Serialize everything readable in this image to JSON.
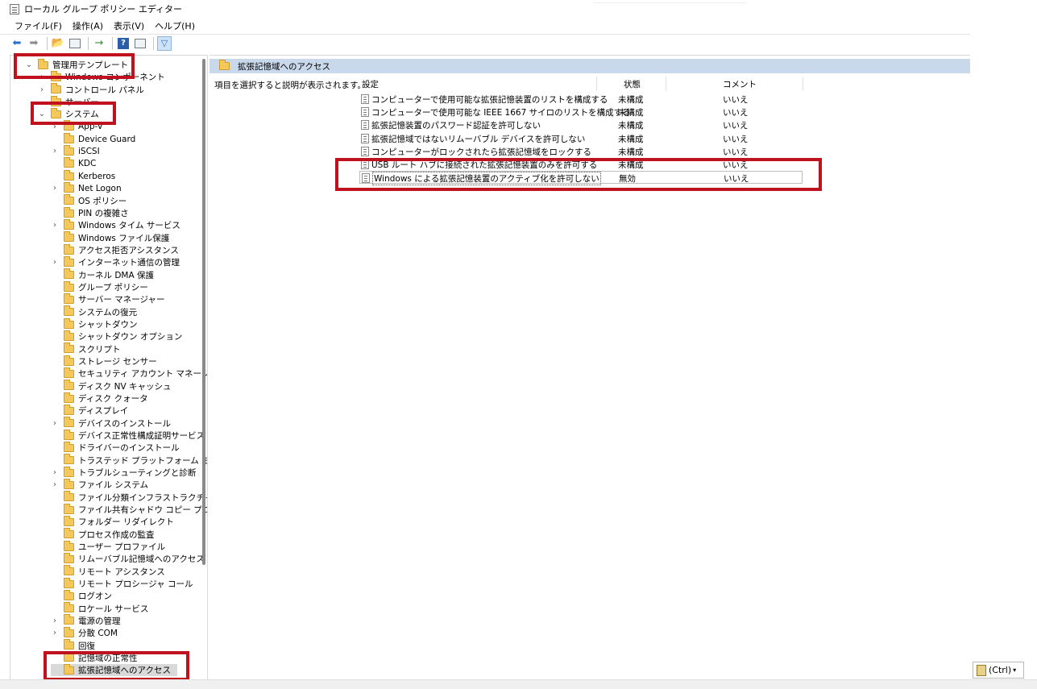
{
  "window": {
    "title": "ローカル グループ ポリシー エディター"
  },
  "menu": [
    "ファイル(F)",
    "操作(A)",
    "表示(V)",
    "ヘルプ(H)"
  ],
  "toolbar": {
    "icons": [
      "back-arrow-icon",
      "forward-arrow-icon",
      "up-folder-icon",
      "show-hide-tree-icon",
      "export-list-icon",
      "help-icon",
      "properties-icon",
      "filter-icon"
    ]
  },
  "tree": [
    {
      "label": "管理用テンプレート",
      "level": 0,
      "expander": "expanded"
    },
    {
      "label": "Windows コンポーネント",
      "level": 1,
      "expander": "collapsed"
    },
    {
      "label": "コントロール パネル",
      "level": 1,
      "expander": "collapsed"
    },
    {
      "label": "サーバー",
      "level": 1,
      "expander": "none"
    },
    {
      "label": "システム",
      "level": 1,
      "expander": "expanded"
    },
    {
      "label": "App-V",
      "level": 2,
      "expander": "collapsed"
    },
    {
      "label": "Device Guard",
      "level": 2,
      "expander": "none"
    },
    {
      "label": "iSCSI",
      "level": 2,
      "expander": "collapsed"
    },
    {
      "label": "KDC",
      "level": 2,
      "expander": "none"
    },
    {
      "label": "Kerberos",
      "level": 2,
      "expander": "none"
    },
    {
      "label": "Net Logon",
      "level": 2,
      "expander": "collapsed"
    },
    {
      "label": "OS ポリシー",
      "level": 2,
      "expander": "none"
    },
    {
      "label": "PIN の複雑さ",
      "level": 2,
      "expander": "none"
    },
    {
      "label": "Windows タイム サービス",
      "level": 2,
      "expander": "collapsed"
    },
    {
      "label": "Windows ファイル保護",
      "level": 2,
      "expander": "none"
    },
    {
      "label": "アクセス拒否アシスタンス",
      "level": 2,
      "expander": "none"
    },
    {
      "label": "インターネット通信の管理",
      "level": 2,
      "expander": "collapsed"
    },
    {
      "label": "カーネル DMA 保護",
      "level": 2,
      "expander": "none"
    },
    {
      "label": "グループ ポリシー",
      "level": 2,
      "expander": "none"
    },
    {
      "label": "サーバー マネージャー",
      "level": 2,
      "expander": "none"
    },
    {
      "label": "システムの復元",
      "level": 2,
      "expander": "none"
    },
    {
      "label": "シャットダウン",
      "level": 2,
      "expander": "none"
    },
    {
      "label": "シャットダウン オプション",
      "level": 2,
      "expander": "none"
    },
    {
      "label": "スクリプト",
      "level": 2,
      "expander": "none"
    },
    {
      "label": "ストレージ センサー",
      "level": 2,
      "expander": "none"
    },
    {
      "label": "セキュリティ アカウント マネージャー",
      "level": 2,
      "expander": "none"
    },
    {
      "label": "ディスク NV キャッシュ",
      "level": 2,
      "expander": "none"
    },
    {
      "label": "ディスク クォータ",
      "level": 2,
      "expander": "none"
    },
    {
      "label": "ディスプレイ",
      "level": 2,
      "expander": "none"
    },
    {
      "label": "デバイスのインストール",
      "level": 2,
      "expander": "collapsed"
    },
    {
      "label": "デバイス正常性構成証明サービス",
      "level": 2,
      "expander": "none"
    },
    {
      "label": "ドライバーのインストール",
      "level": 2,
      "expander": "none"
    },
    {
      "label": "トラステッド プラットフォーム モジュール",
      "level": 2,
      "expander": "none"
    },
    {
      "label": "トラブルシューティングと診断",
      "level": 2,
      "expander": "collapsed"
    },
    {
      "label": "ファイル システム",
      "level": 2,
      "expander": "collapsed"
    },
    {
      "label": "ファイル分類インフラストラクチャ",
      "level": 2,
      "expander": "none"
    },
    {
      "label": "ファイル共有シャドウ コピー プロバイダー",
      "level": 2,
      "expander": "none"
    },
    {
      "label": "フォルダー リダイレクト",
      "level": 2,
      "expander": "none"
    },
    {
      "label": "プロセス作成の監査",
      "level": 2,
      "expander": "none"
    },
    {
      "label": "ユーザー プロファイル",
      "level": 2,
      "expander": "none"
    },
    {
      "label": "リムーバブル記憶域へのアクセス",
      "level": 2,
      "expander": "none"
    },
    {
      "label": "リモート アシスタンス",
      "level": 2,
      "expander": "none"
    },
    {
      "label": "リモート プロシージャ コール",
      "level": 2,
      "expander": "none"
    },
    {
      "label": "ログオン",
      "level": 2,
      "expander": "none"
    },
    {
      "label": "ロケール サービス",
      "level": 2,
      "expander": "none"
    },
    {
      "label": "電源の管理",
      "level": 2,
      "expander": "collapsed"
    },
    {
      "label": "分散 COM",
      "level": 2,
      "expander": "collapsed"
    },
    {
      "label": "回復",
      "level": 2,
      "expander": "none"
    },
    {
      "label": "記憶域の正常性",
      "level": 2,
      "expander": "none"
    },
    {
      "label": "拡張記憶域へのアクセス",
      "level": 2,
      "expander": "none",
      "selected": true
    }
  ],
  "right": {
    "header_title": "拡張記憶域へのアクセス",
    "description": "項目を選択すると説明が表示されます。",
    "columns": {
      "setting": "設定",
      "state": "状態",
      "comment": "コメント"
    },
    "rows": [
      {
        "name": "コンピューターで使用可能な拡張記憶装置のリストを構成する",
        "state": "未構成",
        "comment": "いいえ"
      },
      {
        "name": "コンピューターで使用可能な IEEE 1667 サイロのリストを構成する",
        "state": "未構成",
        "comment": "いいえ"
      },
      {
        "name": "拡張記憶装置のパスワード認証を許可しない",
        "state": "未構成",
        "comment": "いいえ"
      },
      {
        "name": "拡張記憶域ではないリムーバブル デバイスを許可しない",
        "state": "未構成",
        "comment": "いいえ"
      },
      {
        "name": "コンピューターがロックされたら拡張記憶域をロックする",
        "state": "未構成",
        "comment": "いいえ"
      },
      {
        "name": "USB ルート ハブに接続された拡張記憶装置のみを許可する",
        "state": "未構成",
        "comment": "いいえ"
      },
      {
        "name": "Windows による拡張記憶装置のアクティブ化を許可しない",
        "state": "無効",
        "comment": "いいえ",
        "focused": true
      }
    ]
  },
  "paste_options": {
    "label": "(Ctrl)"
  },
  "colors": {
    "highlight_box": "#c0111f",
    "header_bar": "#c9d8ea"
  }
}
